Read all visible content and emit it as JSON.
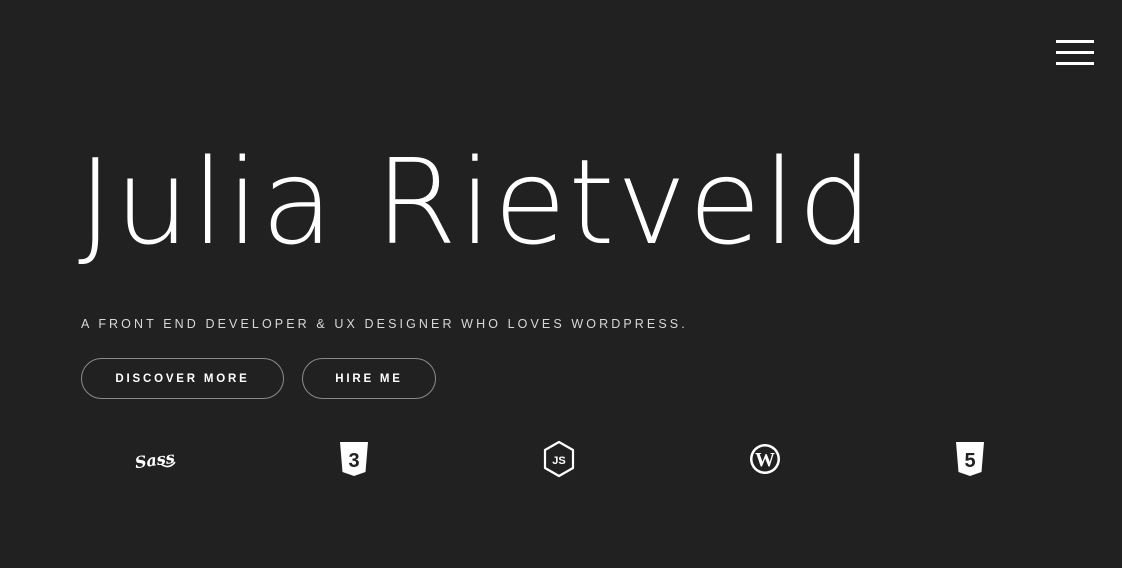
{
  "header": {
    "menu_icon": "hamburger-menu-icon"
  },
  "hero": {
    "title": "Julia Rietveld",
    "subtitle": "A FRONT END DEVELOPER & UX DESIGNER WHO LOVES WORDPRESS."
  },
  "actions": {
    "discover_label": "DISCOVER MORE",
    "hire_label": "HIRE ME"
  },
  "tech_icons": [
    {
      "icon": "sass-icon",
      "text": "Sass"
    },
    {
      "icon": "css3-icon",
      "text": "3"
    },
    {
      "icon": "nodejs-icon",
      "text": "JS"
    },
    {
      "icon": "wordpress-icon"
    },
    {
      "icon": "html5-icon",
      "text": "5"
    }
  ],
  "colors": {
    "background": "#212121",
    "text": "#ffffff",
    "subtitle": "#d8d8d8",
    "button_border": "#8a8a8a"
  }
}
